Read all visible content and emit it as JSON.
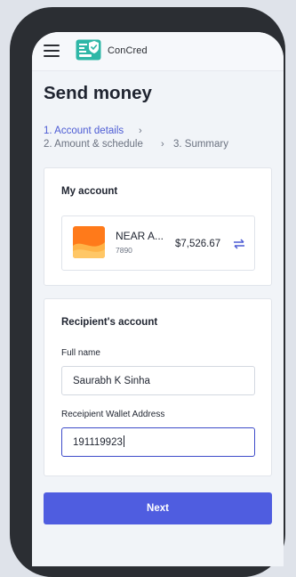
{
  "app": {
    "brand": "ConCred"
  },
  "page": {
    "title": "Send money"
  },
  "steps": [
    {
      "label": "1. Account details"
    },
    {
      "label": "2. Amount & schedule"
    },
    {
      "label": "3. Summary"
    }
  ],
  "my_account": {
    "heading": "My account",
    "account": {
      "name": "NEAR A...",
      "number": "7890",
      "balance": "$7,526.67"
    }
  },
  "recipient": {
    "heading": "Recipient's account",
    "full_name_label": "Full name",
    "full_name_value": "Saurabh K Sinha",
    "wallet_label": "Receipient Wallet Address",
    "wallet_value": "191119923"
  },
  "actions": {
    "next_label": "Next"
  },
  "colors": {
    "accent": "#4f5de0",
    "active_step": "#4c5bd4",
    "device_frame": "#2b2e33",
    "logo_teal": "#2fb7a7"
  },
  "icons": [
    "menu-icon",
    "logo-icon",
    "chevron-right-icon",
    "swap-icon"
  ]
}
